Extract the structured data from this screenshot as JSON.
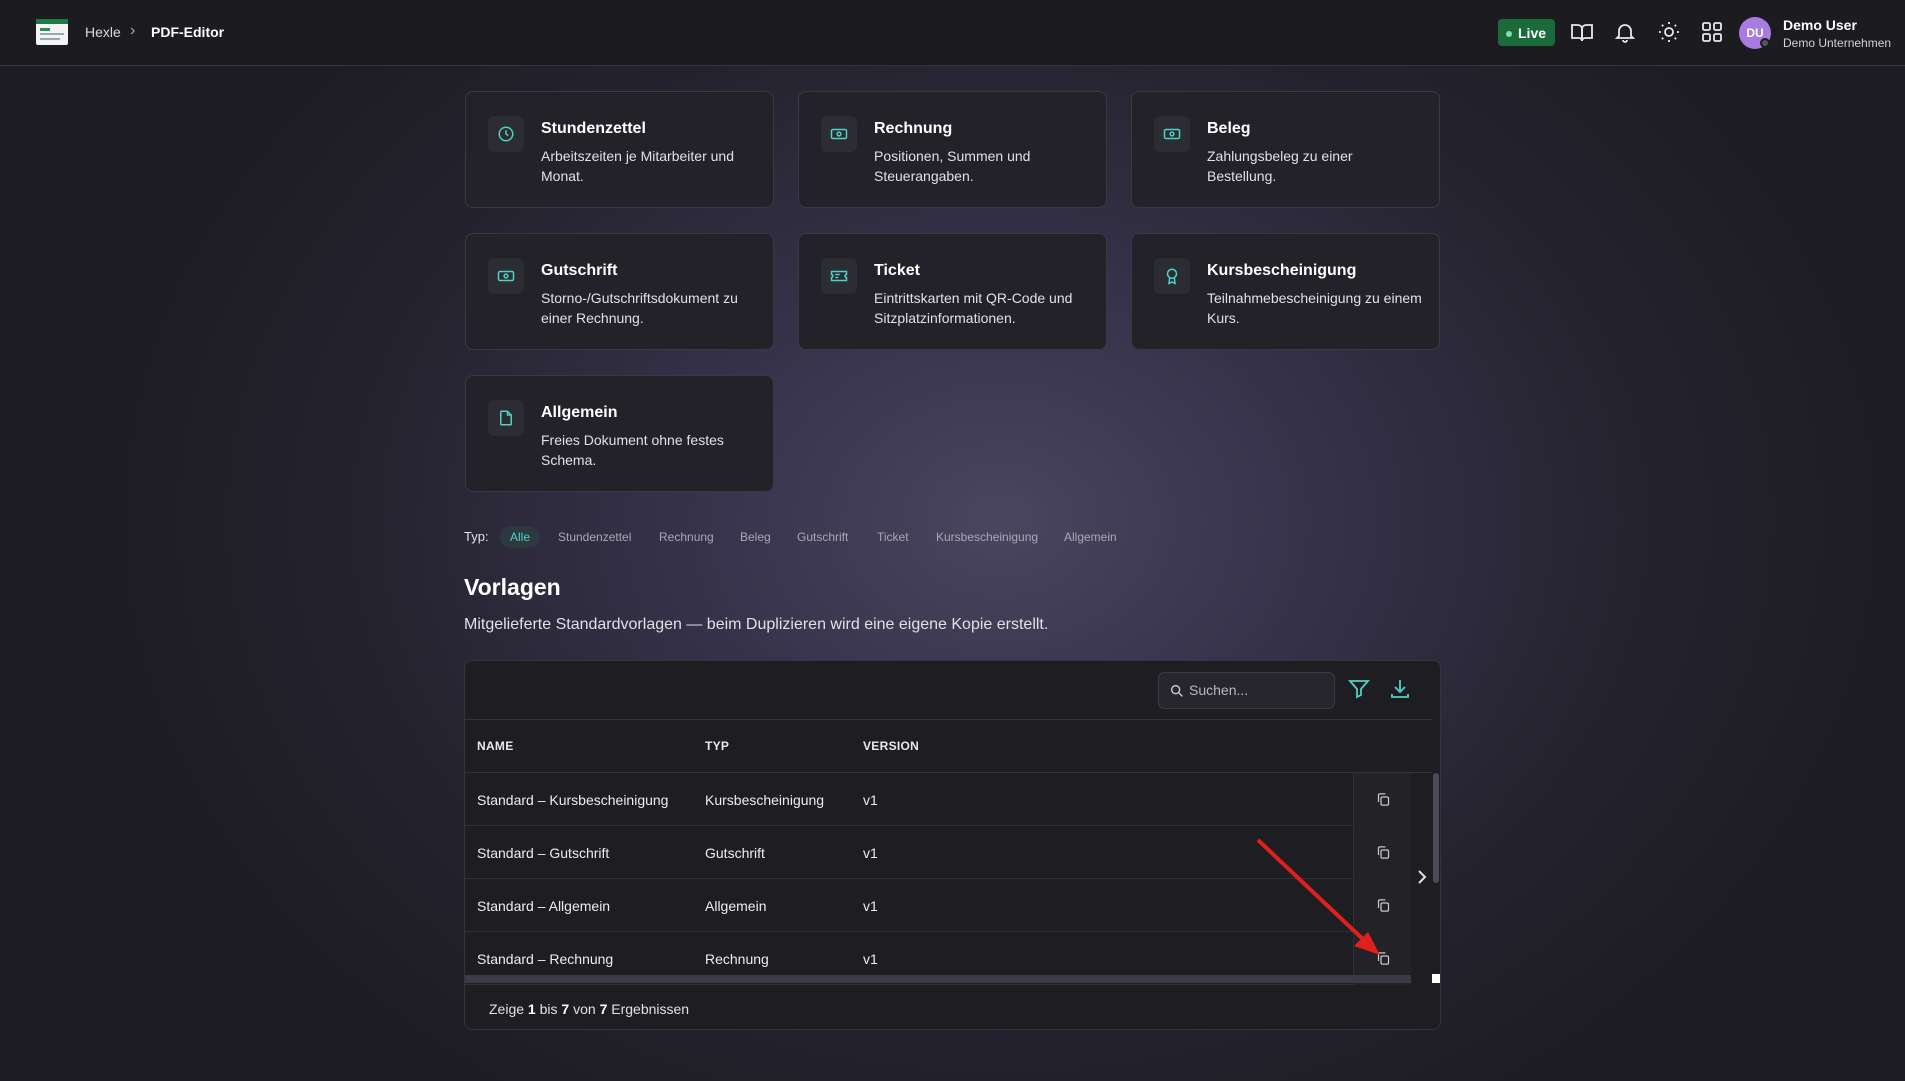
{
  "header": {
    "breadcrumb_home": "Hexle",
    "breadcrumb_separator": "›",
    "breadcrumb_current": "PDF-Editor",
    "live_label": "Live",
    "avatar_initials": "DU",
    "user_name": "Demo User",
    "user_company": "Demo Unternehmen"
  },
  "cards": [
    {
      "title": "Stundenzettel",
      "desc": "Arbeitszeiten je Mitarbeiter und Monat.",
      "icon": "clock-icon"
    },
    {
      "title": "Rechnung",
      "desc": "Positionen, Summen und Steuerangaben.",
      "icon": "banknote-icon"
    },
    {
      "title": "Beleg",
      "desc": "Zahlungsbeleg zu einer Bestellung.",
      "icon": "banknote-icon"
    },
    {
      "title": "Gutschrift",
      "desc": "Storno-/Gutschriftsdokument zu einer Rechnung.",
      "icon": "banknote-icon"
    },
    {
      "title": "Ticket",
      "desc": "Eintrittskarten mit QR-Code und Sitzplatzinformationen.",
      "icon": "ticket-icon"
    },
    {
      "title": "Kursbescheinigung",
      "desc": "Teilnahmebescheinigung zu einem Kurs.",
      "icon": "award-icon"
    },
    {
      "title": "Allgemein",
      "desc": "Freies Dokument ohne festes Schema.",
      "icon": "document-icon"
    }
  ],
  "filter": {
    "label": "Typ:",
    "options": [
      "Alle",
      "Stundenzettel",
      "Rechnung",
      "Beleg",
      "Gutschrift",
      "Ticket",
      "Kursbescheinigung",
      "Allgemein"
    ],
    "selected": "Alle"
  },
  "section": {
    "title": "Vorlagen",
    "subtitle": "Mitgelieferte Standardvorlagen — beim Duplizieren wird eine eigene Kopie erstellt."
  },
  "table": {
    "search_placeholder": "Suchen...",
    "columns": [
      "NAME",
      "TYP",
      "VERSION"
    ],
    "rows": [
      {
        "name": "Standard – Kursbescheinigung",
        "type": "Kursbescheinigung",
        "version": "v1"
      },
      {
        "name": "Standard – Gutschrift",
        "type": "Gutschrift",
        "version": "v1"
      },
      {
        "name": "Standard – Allgemein",
        "type": "Allgemein",
        "version": "v1"
      },
      {
        "name": "Standard – Rechnung",
        "type": "Rechnung",
        "version": "v1"
      }
    ],
    "footer": {
      "prefix": "Zeige",
      "from": "1",
      "to_word": "bis",
      "to": "7",
      "of_word": "von",
      "total": "7",
      "suffix": "Ergebnissen"
    }
  },
  "colors": {
    "accent": "#4fd1c5",
    "live": "#1b6b3a",
    "avatar": "#a77be0",
    "annotation_arrow": "#e0201c"
  }
}
